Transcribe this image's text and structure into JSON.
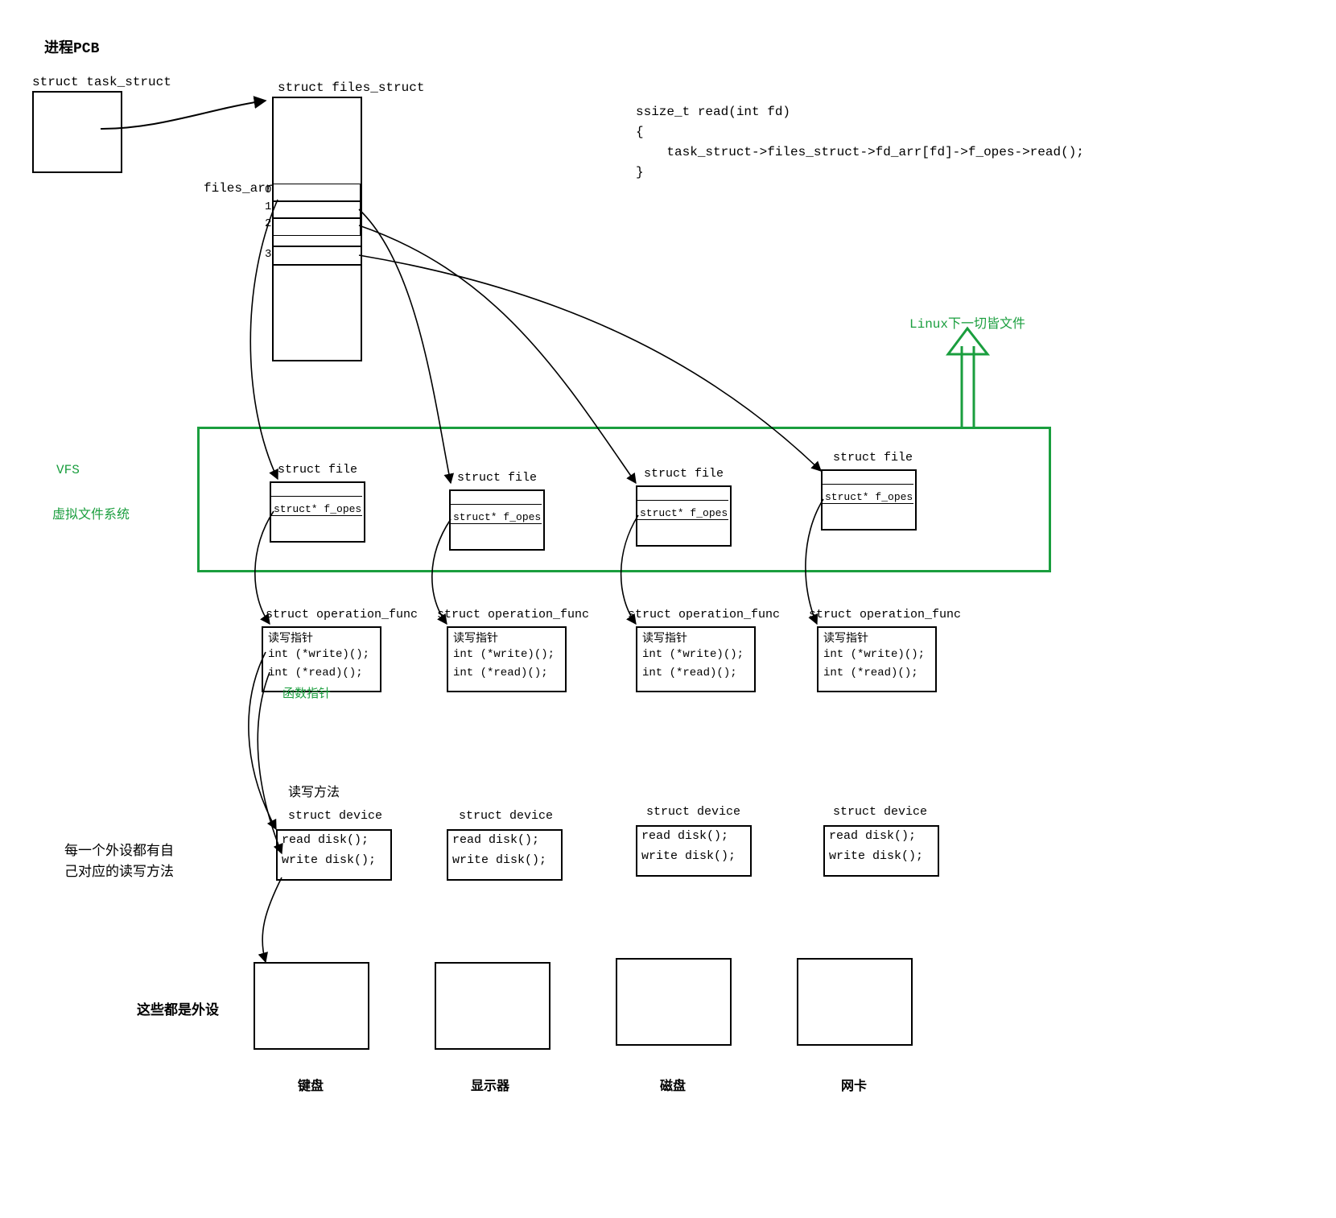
{
  "title": "进程PCB",
  "task_struct_label": "struct task_struct",
  "files_struct_label": "struct files_struct",
  "files_arr_label": "files_arr",
  "fd_nums": [
    "0",
    "1",
    "2",
    "3"
  ],
  "code": {
    "l1": "ssize_t read(int fd)",
    "l2": "{",
    "l3": "    task_struct->files_struct->fd_arr[fd]->f_opes->read();",
    "l4": "}"
  },
  "linux_note": "Linux下一切皆文件",
  "vfs_label1": "VFS",
  "vfs_label2": "虚拟文件系统",
  "struct_file_label": "struct file",
  "f_opes_label": "struct* f_opes",
  "op_func_label": "struct operation_func",
  "op_box": {
    "header": "读写指针",
    "l1": "int (*write)();",
    "l2": "int (*read)();"
  },
  "func_ptr_note": "  函数指针",
  "rw_method_label": "读写方法",
  "struct_device_label": "struct device",
  "device_box": {
    "l1": "read disk();",
    "l2": "write disk();"
  },
  "side_note1": "每一个外设都有自",
  "side_note2": "己对应的读写方法",
  "peripherals_note": "这些都是外设",
  "dev_names": [
    "键盘",
    "显示器",
    "磁盘",
    "网卡"
  ]
}
